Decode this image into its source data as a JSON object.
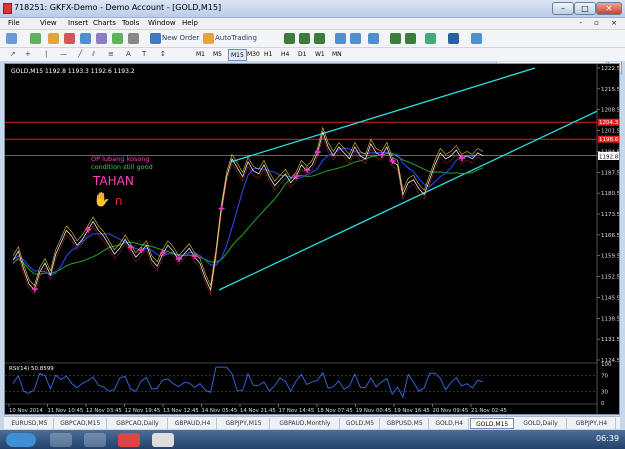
{
  "window": {
    "title": "718251: GKFX-Demo - Demo Account - [GOLD,M15]",
    "min": "–",
    "max": "□",
    "close": "✕"
  },
  "menu": [
    {
      "name": "menu-file",
      "label": "File"
    },
    {
      "name": "menu-view",
      "label": "View"
    },
    {
      "name": "menu-insert",
      "label": "Insert"
    },
    {
      "name": "menu-charts",
      "label": "Charts"
    },
    {
      "name": "menu-tools",
      "label": "Tools"
    },
    {
      "name": "menu-window",
      "label": "Window"
    },
    {
      "name": "menu-help",
      "label": "Help"
    }
  ],
  "mdi_controls": "- ▫ ×",
  "toolbar": {
    "new_order": "New Order",
    "autotrading": "AutoTrading",
    "search_placeholder": "",
    "search_icon": "search-icon"
  },
  "timeframes": [
    "M1",
    "M5",
    "M15",
    "M30",
    "H1",
    "H4",
    "D1",
    "W1",
    "MN"
  ],
  "active_timeframe": "M15",
  "chart_data": {
    "type": "line",
    "title": "GOLD,M15  1192.8 1193.3 1192.6 1193.2",
    "price_ticks": [
      "1222.5",
      "1215.5",
      "1208.5",
      "1201.5",
      "1194.5",
      "1187.5",
      "1180.5",
      "1173.5",
      "1166.5",
      "1159.5",
      "1152.5",
      "1145.5",
      "1138.5",
      "1131.5",
      "1124.5"
    ],
    "price_labels": [
      {
        "value": "1204.3",
        "color": "#e02020"
      },
      {
        "value": "1198.6",
        "color": "#e02020"
      },
      {
        "value": "1193.2",
        "color": "#ffffff"
      },
      {
        "value": "1192.8",
        "color": "#ffffff"
      }
    ],
    "time_ticks": [
      "10 Nov 2014",
      "11 Nov 10:45",
      "12 Nov 03:45",
      "12 Nov 19:45",
      "13 Nov 12:45",
      "14 Nov 05:45",
      "14 Nov 21:45",
      "17 Nov 14:45",
      "18 Nov 07:45",
      "19 Nov 00:45",
      "19 Nov 16:45",
      "20 Nov 09:45",
      "21 Nov 02:45"
    ],
    "ylim": [
      1124.5,
      1222.5
    ],
    "close": [
      1158,
      1161,
      1155,
      1150,
      1148,
      1154,
      1157,
      1153,
      1160,
      1164,
      1168,
      1166,
      1163,
      1165,
      1168,
      1171,
      1168,
      1166,
      1163,
      1160,
      1162,
      1165,
      1162,
      1159,
      1161,
      1163,
      1158,
      1156,
      1160,
      1163,
      1161,
      1158,
      1160,
      1162,
      1159,
      1157,
      1152,
      1148,
      1160,
      1175,
      1186,
      1192,
      1189,
      1186,
      1191,
      1188,
      1187,
      1190,
      1186,
      1183,
      1185,
      1187,
      1184,
      1186,
      1190,
      1188,
      1190,
      1194,
      1201,
      1196,
      1193,
      1196,
      1194,
      1192,
      1196,
      1193,
      1192,
      1197,
      1194,
      1193,
      1196,
      1191,
      1190,
      1180,
      1184,
      1185,
      1182,
      1180,
      1185,
      1190,
      1194,
      1192,
      1193,
      1195,
      1192,
      1193,
      1192,
      1194,
      1193
    ],
    "annotations": {
      "note1": "OP lubang kosong",
      "note2": "condition still good",
      "note3": "TAHAN"
    },
    "rsi": {
      "label": "RSI(14) 50.8599",
      "ticks": [
        "100",
        "70",
        "30",
        "0"
      ]
    }
  },
  "tabs": [
    "EURUSD,M5",
    "GBPCAD,M15",
    "GBPCAD,Daily",
    "GBPAUD,H4",
    "GBPJPY,M15",
    "GBPAUD,Monthly",
    "GOLD,M5",
    "GBPUSD,M5",
    "GOLD,H4",
    "GOLD,M15",
    "GOLD,Daily",
    "GBPJPY,H4"
  ],
  "active_tab": "GOLD,M15",
  "taskbar": {
    "clock": "06:39"
  }
}
